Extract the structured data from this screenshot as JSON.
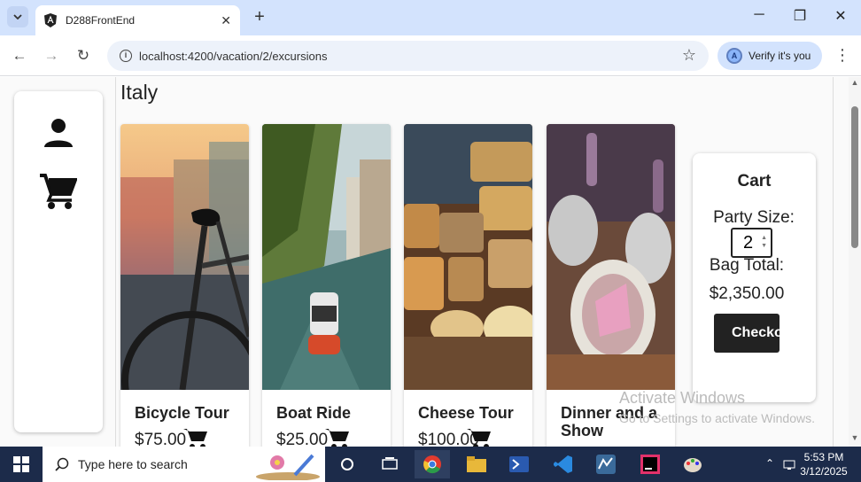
{
  "browser": {
    "tab_title": "D288FrontEnd",
    "url": "localhost:4200/vacation/2/excursions",
    "verify_label": "Verify it's you",
    "verify_avatar": "A"
  },
  "page": {
    "title": "Italy"
  },
  "excursions": [
    {
      "name": "Bicycle Tour",
      "price": "$75.00"
    },
    {
      "name": "Boat Ride",
      "price": "$25.00"
    },
    {
      "name": "Cheese Tour",
      "price": "$100.00"
    },
    {
      "name": "Dinner and a Show",
      "price": ""
    }
  ],
  "cart": {
    "heading": "Cart",
    "party_label": "Party Size:",
    "party_size": "2",
    "bag_label": "Bag Total:",
    "total": "$2,350.00",
    "checkout_label": "Checkout"
  },
  "watermark": {
    "line1": "Activate Windows",
    "line2": "Go to Settings to activate Windows."
  },
  "taskbar": {
    "search_placeholder": "Type here to search",
    "time": "5:53 PM",
    "date": "3/12/2025"
  }
}
